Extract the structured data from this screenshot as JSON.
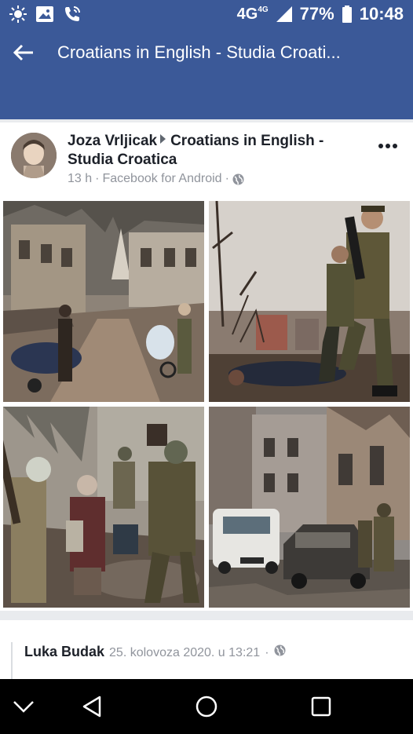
{
  "status_bar": {
    "network": "4G",
    "network_sup": "4G",
    "battery": "77%",
    "time": "10:48",
    "icons": [
      "sun-icon",
      "image-icon",
      "call-icon",
      "signal-icon",
      "battery-icon"
    ]
  },
  "header": {
    "title": "Croatians in English - Studia Croati..."
  },
  "post": {
    "author": "Joza Vrljicak",
    "group": "Croatians in English - Studia Croatica",
    "time": "13 h",
    "source": "Facebook for Android",
    "separator": "·",
    "photos": [
      {
        "name": "destroyed-street-refugees-photo"
      },
      {
        "name": "soldiers-standing-over-body-photo"
      },
      {
        "name": "soldier-helping-elderly-woman-photo"
      },
      {
        "name": "damaged-cars-ruined-buildings-photo"
      }
    ]
  },
  "comment": {
    "author": "Luka Budak",
    "time": "25. kolovoza 2020. u 13:21",
    "separator": "·"
  },
  "colors": {
    "brand": "#3b5998",
    "background": "#e9ebee",
    "text_primary": "#1d2129",
    "text_secondary": "#90949c"
  }
}
